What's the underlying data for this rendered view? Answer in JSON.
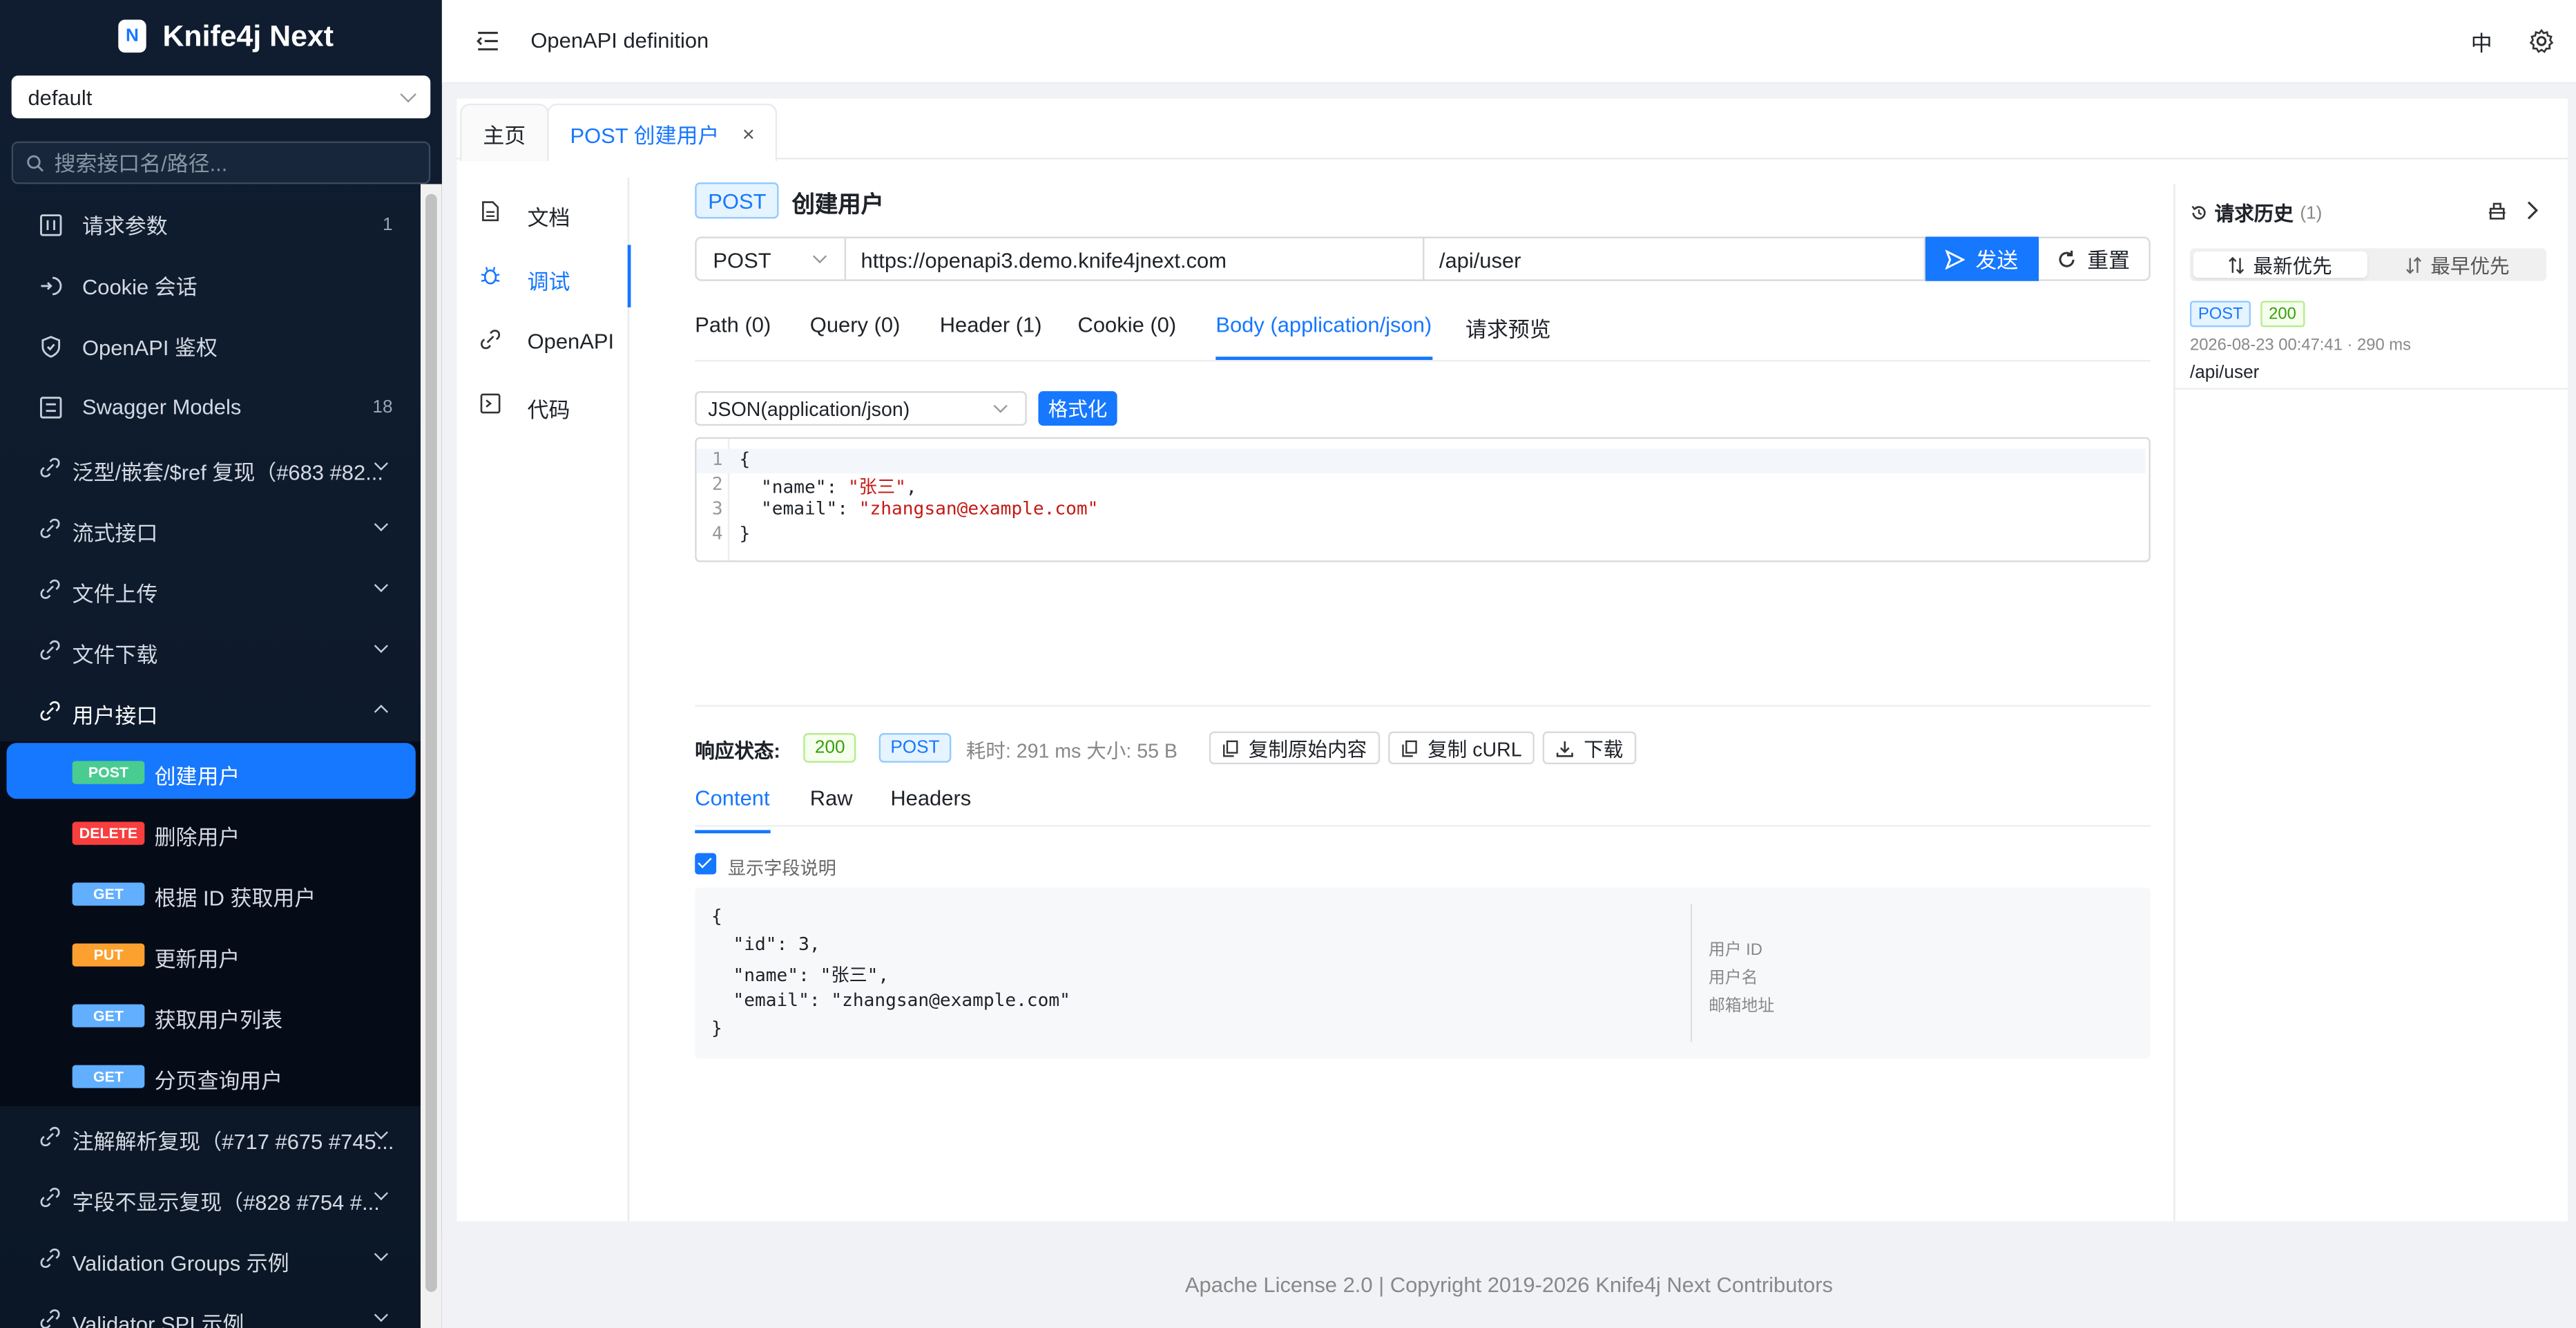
{
  "sidebar": {
    "logo_letter": "N",
    "app_name": "Knife4j Next",
    "group_select": "default",
    "search_placeholder": "搜索接口名/路径...",
    "items": [
      {
        "label": "请求参数",
        "count": "1",
        "icon": "sliders-icon"
      },
      {
        "label": "Cookie 会话",
        "count": "",
        "icon": "login-icon"
      },
      {
        "label": "OpenAPI 鉴权",
        "count": "",
        "icon": "shield-icon"
      },
      {
        "label": "Swagger Models",
        "count": "18",
        "icon": "list-icon"
      }
    ],
    "groups_before": [
      {
        "label": "泛型/嵌套/$ref 复现（#683 #82..."
      },
      {
        "label": "流式接口"
      },
      {
        "label": "文件上传"
      },
      {
        "label": "文件下载"
      }
    ],
    "open_group": {
      "label": "用户接口",
      "endpoints": [
        {
          "method": "POST",
          "label": "创建用户"
        },
        {
          "method": "DELETE",
          "label": "删除用户"
        },
        {
          "method": "GET",
          "label": "根据 ID 获取用户"
        },
        {
          "method": "PUT",
          "label": "更新用户"
        },
        {
          "method": "GET",
          "label": "获取用户列表"
        },
        {
          "method": "GET",
          "label": "分页查询用户"
        }
      ]
    },
    "groups_after": [
      {
        "label": "注解解析复现（#717 #675 #745..."
      },
      {
        "label": "字段不显示复现（#828 #754 #..."
      },
      {
        "label": "Validation Groups 示例"
      },
      {
        "label": "Validator SPI 示例"
      }
    ]
  },
  "header": {
    "title": "OpenAPI definition",
    "lang": "中"
  },
  "tabs": {
    "home": "主页",
    "current": "POST 创建用户",
    "close": "×"
  },
  "left_nav": [
    {
      "label": "文档",
      "icon": "document-icon"
    },
    {
      "label": "调试",
      "icon": "bug-icon"
    },
    {
      "label": "OpenAPI",
      "icon": "link-icon"
    },
    {
      "label": "代码",
      "icon": "terminal-icon"
    }
  ],
  "api": {
    "method": "POST",
    "name": "创建用户",
    "method_select": "POST",
    "host": "https://openapi3.demo.knife4jnext.com",
    "path": "/api/user",
    "send_label": "发送",
    "reset_label": "重置"
  },
  "request_tabs": [
    "Path (0)",
    "Query (0)",
    "Header (1)",
    "Cookie (0)",
    "Body (application/json)",
    "请求预览"
  ],
  "body": {
    "content_type": "JSON(application/json)",
    "format_label": "格式化",
    "lines": [
      {
        "num": "1",
        "text": "{"
      },
      {
        "num": "2",
        "key": "  \"name\": ",
        "value": "\"张三\"",
        "tail": ","
      },
      {
        "num": "3",
        "key": "  \"email\": ",
        "value": "\"zhangsan@example.com\"",
        "tail": ""
      },
      {
        "num": "4",
        "text": "}"
      }
    ]
  },
  "response": {
    "label": "响应状态:",
    "status": "200",
    "method": "POST",
    "meta": "耗时: 291 ms  大小: 55 B",
    "copy_raw": "复制原始内容",
    "copy_curl": "复制 cURL",
    "download": "下载",
    "tabs": [
      "Content",
      "Raw",
      "Headers"
    ],
    "show_desc_label": "显示字段说明",
    "show_desc_checked": true,
    "json_lines": [
      "{",
      "  \"id\": 3,",
      "  \"name\": \"张三\",",
      "  \"email\": \"zhangsan@example.com\"",
      "}"
    ],
    "field_desc": [
      "用户 ID",
      "用户名",
      "邮箱地址"
    ]
  },
  "history": {
    "title": "请求历史",
    "count": "(1)",
    "sort_newest": "最新优先",
    "sort_oldest": "最早优先",
    "entries": [
      {
        "method": "POST",
        "status": "200",
        "time": "2026-08-23 00:47:41 · 290 ms",
        "path": "/api/user"
      }
    ]
  },
  "footer": {
    "text": "Apache License 2.0 | Copyright 2019-2026 Knife4j Next Contributors"
  },
  "colors": {
    "accent": "#1677ff",
    "sidebar_bg": "#0d1a2b",
    "post": "#49cc90",
    "delete": "#f93e3e",
    "get": "#61affe",
    "put": "#fca130"
  }
}
